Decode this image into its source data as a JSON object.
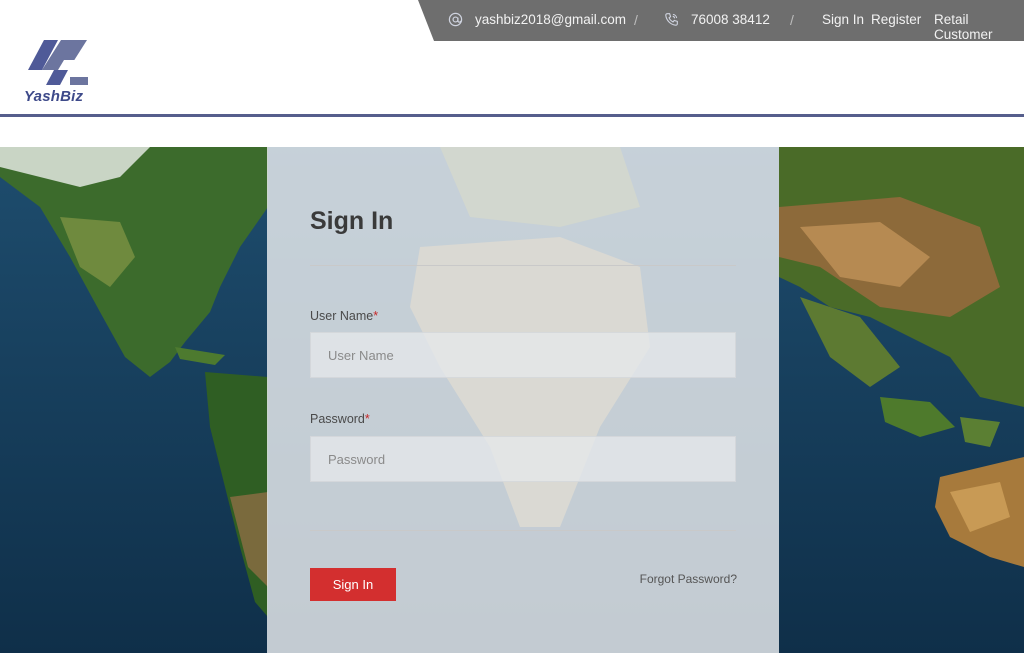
{
  "topbar": {
    "email": "yashbiz2018@gmail.com",
    "phone": "76008 38412",
    "separator": "/",
    "links": {
      "sign_in": "Sign In",
      "register": "Register",
      "retail_customer": "Retail Customer"
    },
    "icons": [
      "at-icon",
      "phone-icon"
    ]
  },
  "header": {
    "logo_text": "YashBiz",
    "brand_color": "#3e4a8a"
  },
  "signin": {
    "title": "Sign In",
    "username_label": "User Name",
    "username_placeholder": "User Name",
    "username_value": "",
    "password_label": "Password",
    "password_placeholder": "Password",
    "password_value": "",
    "required_marker": "*",
    "submit_label": "Sign In",
    "forgot_label": "Forgot Password?",
    "accent_color": "#d32f2f"
  }
}
